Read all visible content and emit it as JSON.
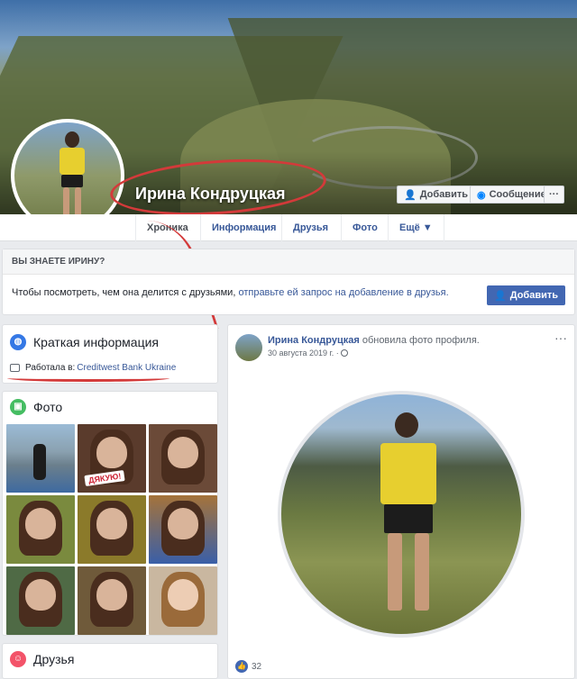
{
  "profile": {
    "name": "Ирина Кондруцкая",
    "add_friend_label": "Добавить",
    "message_label": "Сообщение",
    "more_label": "···"
  },
  "nav": {
    "tabs": [
      "Хроника",
      "Информация",
      "Друзья",
      "Фото",
      "Ещё ▼"
    ]
  },
  "know_box": {
    "title": "ВЫ ЗНАЕТЕ ИРИНУ?",
    "text_before": "Чтобы посмотреть, чем она делится с друзьями, ",
    "text_link": "отправьте ей запрос на добавление в друзья.",
    "add_label": "Добавить"
  },
  "intro": {
    "title": "Краткая информация",
    "work_prefix": "Работала в: ",
    "work_place": "Creditwest Bank Ukraine"
  },
  "photos": {
    "title": "Фото",
    "badge": "ДЯКУЮ!"
  },
  "friends": {
    "title": "Друзья"
  },
  "post": {
    "author": "Ирина Кондруцкая",
    "action": " обновила фото профиля.",
    "date": "30 августа 2019 г. · ",
    "menu": "···",
    "likes": "32"
  },
  "colors": {
    "accent": "#4267b2",
    "link": "#385898",
    "annotation": "#d33a3a",
    "shirt": "#e7cf2f"
  },
  "icons": {
    "globe": "globe-icon",
    "briefcase": "briefcase-icon",
    "photo": "photo-icon",
    "friends": "friends-icon",
    "like": "like-icon"
  }
}
